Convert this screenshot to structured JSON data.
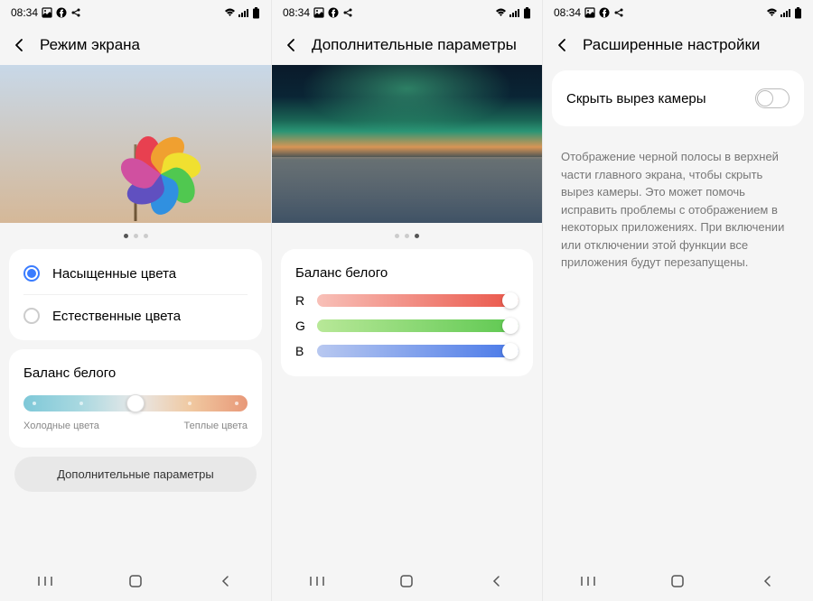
{
  "status": {
    "time": "08:34"
  },
  "screen1": {
    "title": "Режим экрана",
    "option1": "Насыщенные цвета",
    "option2": "Естественные цвета",
    "wb_title": "Баланс белого",
    "wb_cold": "Холодные цвета",
    "wb_warm": "Теплые цвета",
    "more_btn": "Дополнительные параметры",
    "page_indicator": {
      "total": 3,
      "active": 0
    }
  },
  "screen2": {
    "title": "Дополнительные параметры",
    "wb_title": "Баланс белого",
    "r_label": "R",
    "g_label": "G",
    "b_label": "B",
    "page_indicator": {
      "total": 3,
      "active": 2
    }
  },
  "screen3": {
    "title": "Расширенные настройки",
    "toggle_label": "Скрыть вырез камеры",
    "toggle_on": false,
    "description": "Отображение черной полосы в верхней части главного экрана, чтобы скрыть вырез камеры. Это может помочь исправить проблемы с отображением в некоторых приложениях. При включении или отключении этой функции все приложения будут перезапущены."
  }
}
